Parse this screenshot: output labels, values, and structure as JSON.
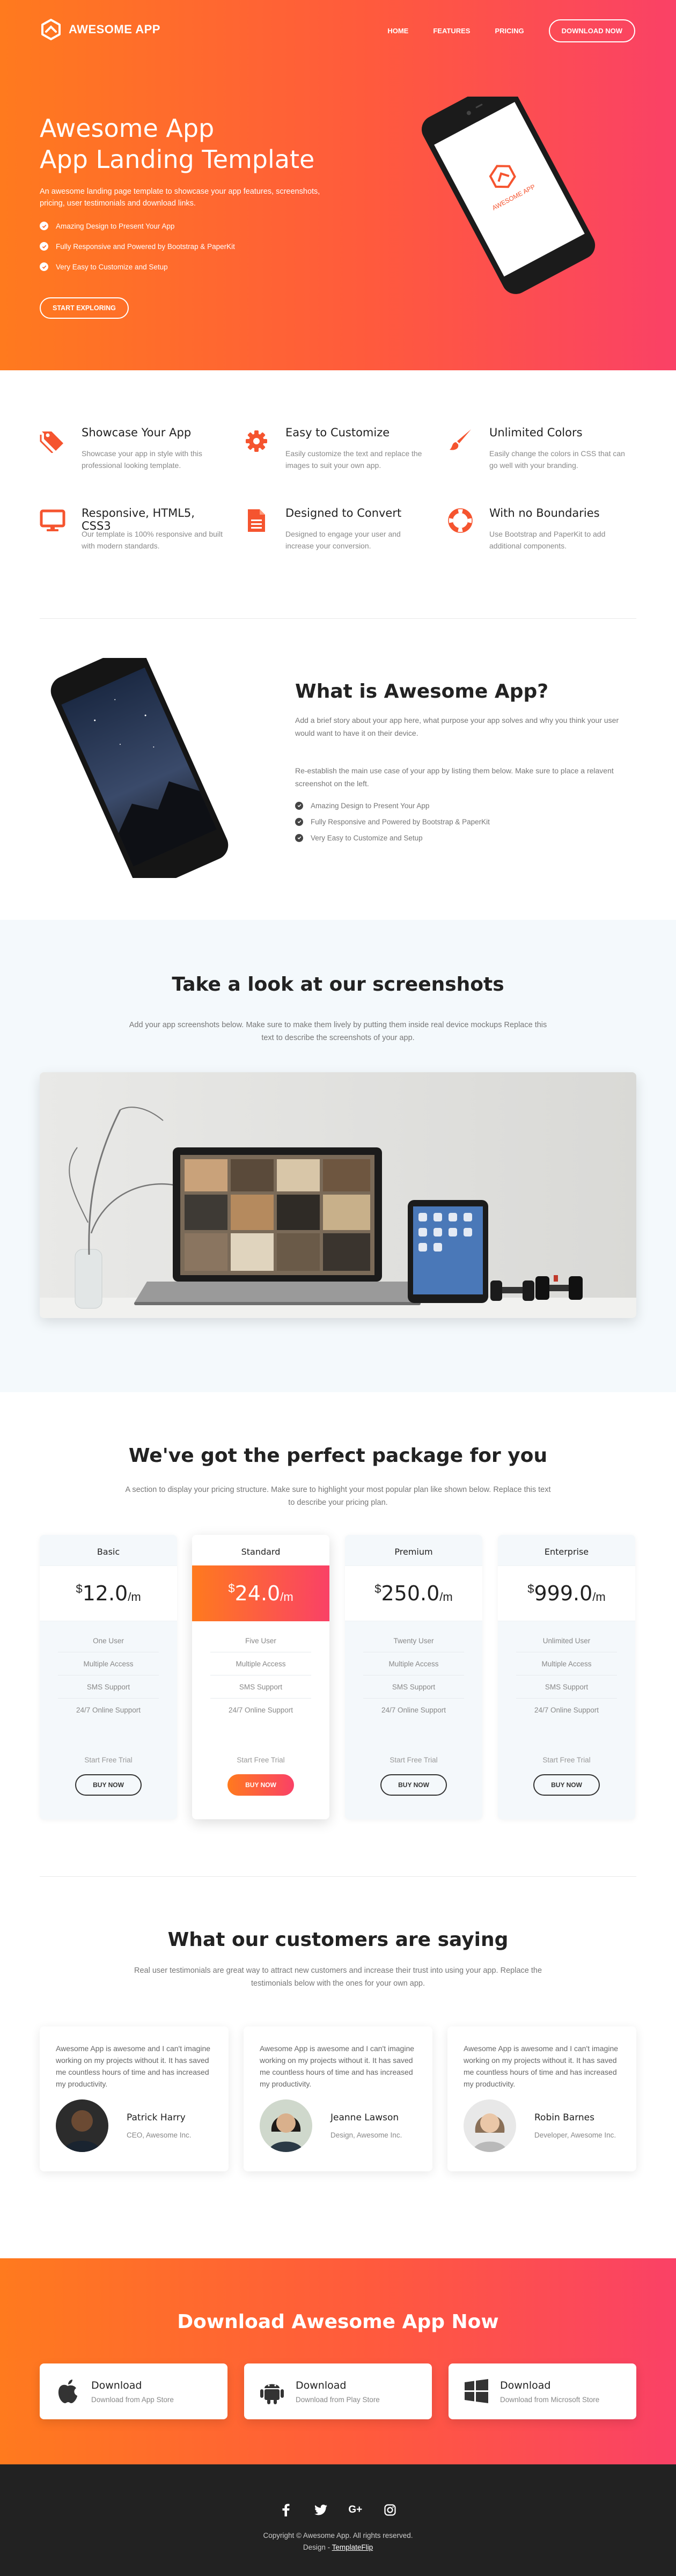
{
  "nav": {
    "brand": "AWESOME APP",
    "links": [
      "HOME",
      "FEATURES",
      "PRICING"
    ],
    "download_label": "DOWNLOAD NOW"
  },
  "hero": {
    "title_line1": "Awesome App",
    "title_line2": "App Landing Template",
    "description": "An awesome landing page template to showcase your app features, screenshots, pricing, user testimonials and download links.",
    "points": [
      "Amazing Design to Present Your App",
      "Fully Responsive and Powered by Bootstrap & PaperKit",
      "Very Easy to Customize and Setup"
    ],
    "cta_label": "START EXPLORING",
    "phone_screen_text": "AWESOME APP"
  },
  "features": [
    {
      "title": "Showcase Your App",
      "text": "Showcase your app in style with this professional looking template.",
      "icon": "tag-icon"
    },
    {
      "title": "Easy to Customize",
      "text": "Easily customize the text and replace the images to suit your own app.",
      "icon": "gear-icon"
    },
    {
      "title": "Unlimited Colors",
      "text": "Easily change the colors in CSS that can go well with your branding.",
      "icon": "brush-icon"
    },
    {
      "title": "Responsive, HTML5, CSS3",
      "text": "Our template is 100% responsive and built with modern standards.",
      "icon": "monitor-icon"
    },
    {
      "title": "Designed to Convert",
      "text": "Designed to engage your user and increase your conversion.",
      "icon": "document-icon"
    },
    {
      "title": "With no Boundaries",
      "text": "Use Bootstrap and PaperKit to add additional components.",
      "icon": "lifebuoy-icon"
    }
  ],
  "about": {
    "title": "What is Awesome App?",
    "p1": "Add a brief story about your app here, what purpose your app solves and why you think your user would want to have it on their device.",
    "p2": "Re-establish the main use case of your app by listing them below. Make sure to place a relavent screenshot on the left.",
    "points": [
      "Amazing Design to Present Your App",
      "Fully Responsive and Powered by Bootstrap & PaperKit",
      "Very Easy to Customize and Setup"
    ]
  },
  "screenshots": {
    "title": "Take a look at our screenshots",
    "subtitle": "Add your app screenshots below. Make sure to make them lively by putting them inside real device mockups Replace this text to describe the screenshots of your app."
  },
  "pricing": {
    "title": "We've got the perfect package for you",
    "subtitle": "A section to display your pricing structure. Make sure to highlight your most popular plan like shown below. Replace this text to describe your pricing plan.",
    "currency": "$",
    "period": "/m",
    "plans": [
      {
        "name": "Basic",
        "price": "12.0",
        "features": [
          "One User",
          "Multiple Access",
          "SMS Support",
          "24/7 Online Support"
        ],
        "trial": "Start Free Trial",
        "button": "BUY NOW"
      },
      {
        "name": "Standard",
        "price": "24.0",
        "features": [
          "Five User",
          "Multiple Access",
          "SMS Support",
          "24/7 Online Support"
        ],
        "trial": "Start Free Trial",
        "button": "BUY NOW"
      },
      {
        "name": "Premium",
        "price": "250.0",
        "features": [
          "Twenty User",
          "Multiple Access",
          "SMS Support",
          "24/7 Online Support"
        ],
        "trial": "Start Free Trial",
        "button": "BUY NOW"
      },
      {
        "name": "Enterprise",
        "price": "999.0",
        "features": [
          "Unlimited User",
          "Multiple Access",
          "SMS Support",
          "24/7 Online Support"
        ],
        "trial": "Start Free Trial",
        "button": "BUY NOW"
      }
    ]
  },
  "testimonials": {
    "title": "What our customers are saying",
    "subtitle": "Real user testimonials are great way to attract new customers and increase their trust into using your app. Replace the testimonials below with the ones for your own app.",
    "items": [
      {
        "quote": "Awesome App is awesome and I can't imagine working on my projects without it. It has saved me countless hours of time and has increased my productivity.",
        "name": "Patrick Harry",
        "role": "CEO, Awesome Inc."
      },
      {
        "quote": "Awesome App is awesome and I can't imagine working on my projects without it. It has saved me countless hours of time and has increased my productivity.",
        "name": "Jeanne Lawson",
        "role": "Design, Awesome Inc."
      },
      {
        "quote": "Awesome App is awesome and I can't imagine working on my projects without it. It has saved me countless hours of time and has increased my productivity.",
        "name": "Robin Barnes",
        "role": "Developer, Awesome Inc."
      }
    ]
  },
  "download": {
    "title": "Download Awesome App Now",
    "items": [
      {
        "label": "Download",
        "sub": "Download from App Store",
        "icon": "apple-icon"
      },
      {
        "label": "Download",
        "sub": "Download from Play Store",
        "icon": "android-icon"
      },
      {
        "label": "Download",
        "sub": "Download from Microsoft Store",
        "icon": "windows-icon"
      }
    ]
  },
  "footer": {
    "socials": [
      "facebook-icon",
      "twitter-icon",
      "google-plus-icon",
      "instagram-icon"
    ],
    "google_plus_text": "G+",
    "copyright": "Copyright © Awesome App. All rights reserved.",
    "design_prefix": "Design - ",
    "design_link": "TemplateFlip"
  },
  "colors": {
    "gradient_start": "#ff7a1e",
    "gradient_end": "#fa4166",
    "accent": "#f5542f",
    "dark": "#222222",
    "light_bg": "#f4f9fc"
  }
}
